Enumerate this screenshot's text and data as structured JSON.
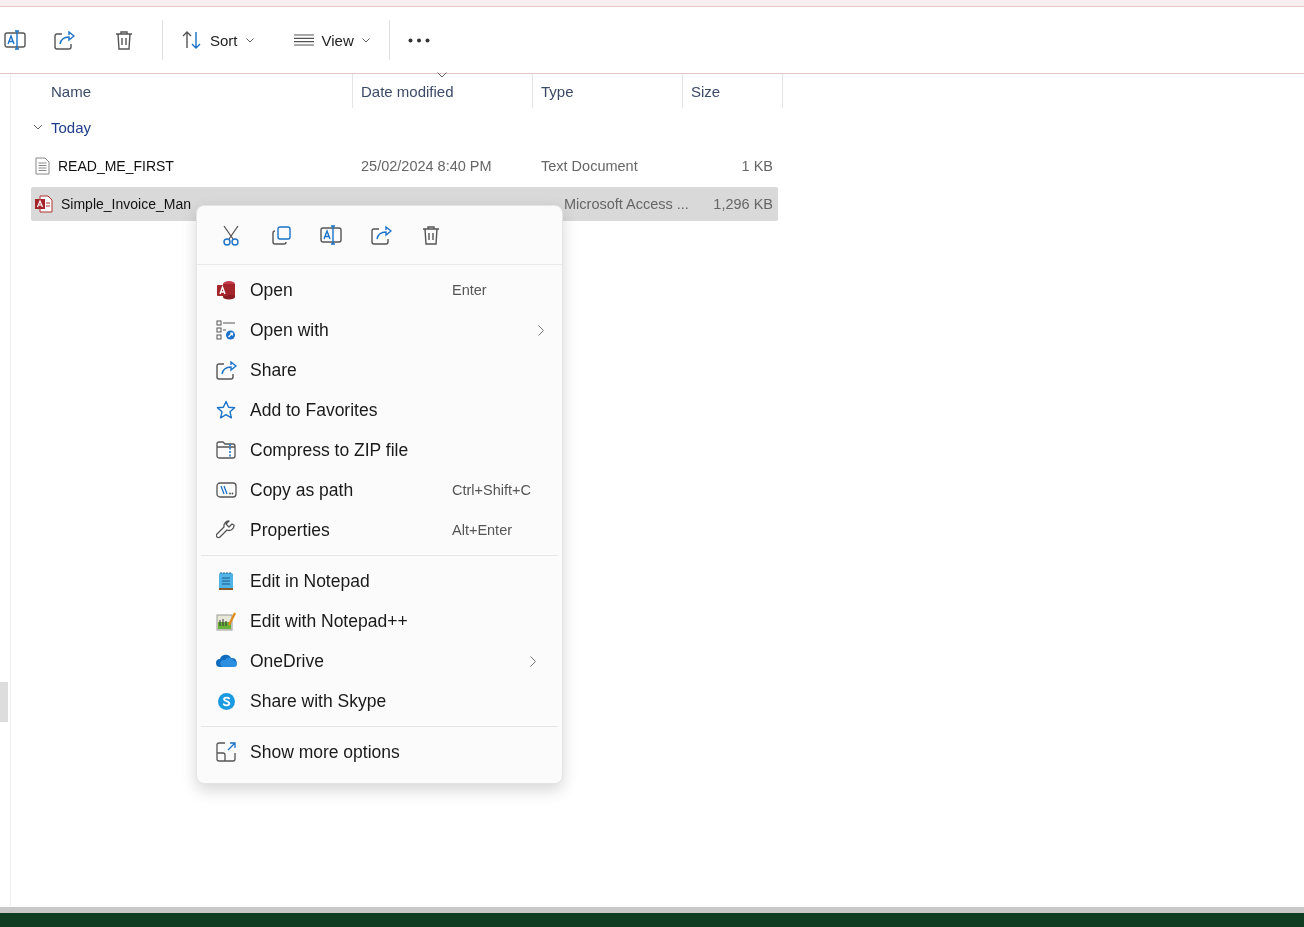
{
  "toolbar": {
    "sort": "Sort",
    "view": "View"
  },
  "columns": [
    "Name",
    "Date modified",
    "Type",
    "Size"
  ],
  "groups": [
    {
      "label": "Today",
      "expanded": true,
      "files": [
        {
          "name": "READ_ME_FIRST",
          "date": "25/02/2024 8:40 PM",
          "type": "Text Document",
          "size": "1 KB",
          "kind": "text",
          "selected": false
        },
        {
          "name": "Simple_Invoice_Man",
          "type": "Microsoft Access ...",
          "size": "1,296 KB",
          "kind": "access",
          "selected": true
        }
      ]
    }
  ],
  "context_menu": {
    "sections": [
      [
        {
          "label": "Open",
          "shortcut": "Enter",
          "submenu": false
        },
        {
          "label": "Open with",
          "submenu": true
        },
        {
          "label": "Share",
          "submenu": false
        },
        {
          "label": "Add to Favorites",
          "submenu": false
        },
        {
          "label": "Compress to ZIP file",
          "submenu": false
        },
        {
          "label": "Copy as path",
          "shortcut": "Ctrl+Shift+C",
          "submenu": false
        },
        {
          "label": "Properties",
          "shortcut": "Alt+Enter",
          "submenu": false
        }
      ],
      [
        {
          "label": "Edit in Notepad",
          "submenu": false
        },
        {
          "label": "Edit with Notepad++",
          "submenu": false
        },
        {
          "label": "OneDrive",
          "submenu": true
        },
        {
          "label": "Share with Skype",
          "submenu": false
        }
      ],
      [
        {
          "label": "Show more options",
          "submenu": false
        }
      ]
    ]
  }
}
